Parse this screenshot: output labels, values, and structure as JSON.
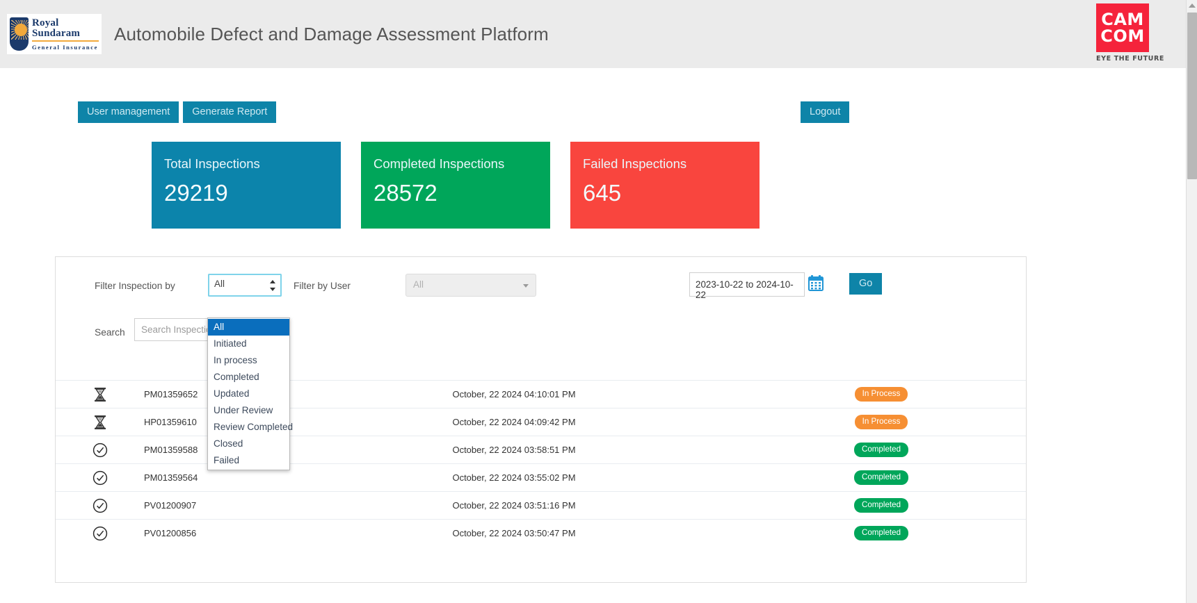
{
  "header": {
    "brand_name": "Royal Sundaram",
    "brand_sub": "General Insurance",
    "title": "Automobile Defect and Damage Assessment Platform",
    "partner_line1": "CAM",
    "partner_line2": "COM",
    "partner_tagline": "EYE THE FUTURE"
  },
  "toolbar": {
    "user_management_label": "User management",
    "generate_report_label": "Generate Report",
    "logout_label": "Logout"
  },
  "cards": [
    {
      "title": "Total Inspections",
      "value": "29219",
      "color": "#0c84ab"
    },
    {
      "title": "Completed Inspections",
      "value": "28572",
      "color": "#00a65a"
    },
    {
      "title": "Failed Inspections",
      "value": "645",
      "color": "#f9453e"
    }
  ],
  "filters": {
    "inspection_label": "Filter Inspection by",
    "inspection_value": "All",
    "inspection_options": [
      "All",
      "Initiated",
      "In process",
      "Completed",
      "Updated",
      "Under Review",
      "Review Completed",
      "Closed",
      "Failed"
    ],
    "inspection_selected_index": 0,
    "user_label": "Filter by User",
    "user_value": "All",
    "date_range": "2023-10-22 to 2024-10-22",
    "go_label": "Go",
    "search_label": "Search",
    "search_value": "",
    "search_placeholder": "Search Inspection"
  },
  "table": {
    "rows": [
      {
        "icon": "hourglass-icon",
        "id": "PM01359652",
        "timestamp": "October, 22 2024 04:10:01 PM",
        "status": "In Process",
        "status_class": "inprocess"
      },
      {
        "icon": "hourglass-icon",
        "id": "HP01359610",
        "timestamp": "October, 22 2024 04:09:42 PM",
        "status": "In Process",
        "status_class": "inprocess"
      },
      {
        "icon": "check-circle-icon",
        "id": "PM01359588",
        "timestamp": "October, 22 2024 03:58:51 PM",
        "status": "Completed",
        "status_class": "completed"
      },
      {
        "icon": "check-circle-icon",
        "id": "PM01359564",
        "timestamp": "October, 22 2024 03:55:02 PM",
        "status": "Completed",
        "status_class": "completed"
      },
      {
        "icon": "check-circle-icon",
        "id": "PV01200907",
        "timestamp": "October, 22 2024 03:51:16 PM",
        "status": "Completed",
        "status_class": "completed"
      },
      {
        "icon": "check-circle-icon",
        "id": "PV01200856",
        "timestamp": "October, 22 2024 03:50:47 PM",
        "status": "Completed",
        "status_class": "completed"
      }
    ]
  },
  "colors": {
    "teal": "#0e84a8",
    "green": "#00a65a",
    "red": "#f9453e",
    "orange": "#f68f33",
    "header_bg": "#ebebeb",
    "dropdown_highlight": "#0a6ebd"
  }
}
